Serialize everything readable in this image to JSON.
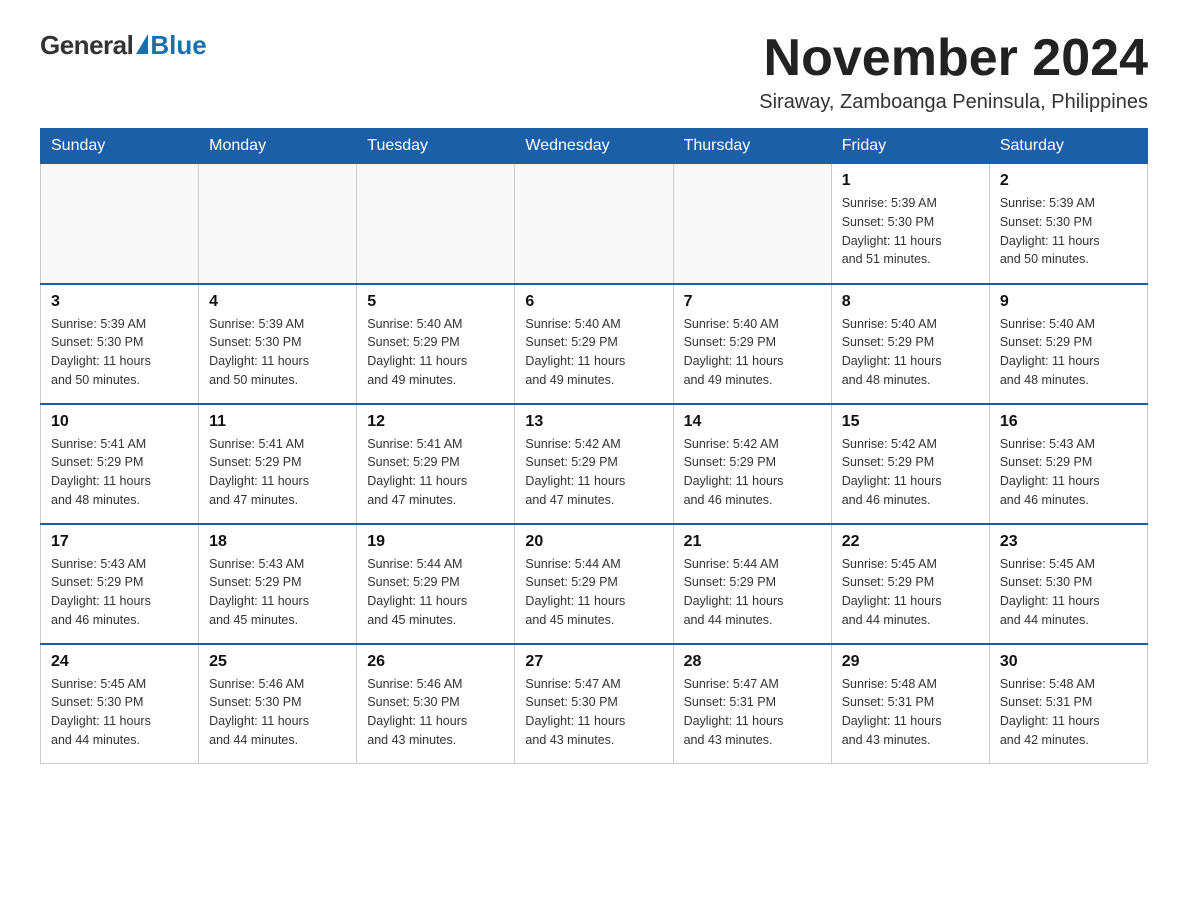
{
  "header": {
    "logo": {
      "general_text": "General",
      "blue_text": "Blue",
      "subtitle": ""
    },
    "title": "November 2024",
    "location": "Siraway, Zamboanga Peninsula, Philippines"
  },
  "days_of_week": [
    "Sunday",
    "Monday",
    "Tuesday",
    "Wednesday",
    "Thursday",
    "Friday",
    "Saturday"
  ],
  "weeks": [
    {
      "days": [
        {
          "num": "",
          "info": ""
        },
        {
          "num": "",
          "info": ""
        },
        {
          "num": "",
          "info": ""
        },
        {
          "num": "",
          "info": ""
        },
        {
          "num": "",
          "info": ""
        },
        {
          "num": "1",
          "info": "Sunrise: 5:39 AM\nSunset: 5:30 PM\nDaylight: 11 hours\nand 51 minutes."
        },
        {
          "num": "2",
          "info": "Sunrise: 5:39 AM\nSunset: 5:30 PM\nDaylight: 11 hours\nand 50 minutes."
        }
      ]
    },
    {
      "days": [
        {
          "num": "3",
          "info": "Sunrise: 5:39 AM\nSunset: 5:30 PM\nDaylight: 11 hours\nand 50 minutes."
        },
        {
          "num": "4",
          "info": "Sunrise: 5:39 AM\nSunset: 5:30 PM\nDaylight: 11 hours\nand 50 minutes."
        },
        {
          "num": "5",
          "info": "Sunrise: 5:40 AM\nSunset: 5:29 PM\nDaylight: 11 hours\nand 49 minutes."
        },
        {
          "num": "6",
          "info": "Sunrise: 5:40 AM\nSunset: 5:29 PM\nDaylight: 11 hours\nand 49 minutes."
        },
        {
          "num": "7",
          "info": "Sunrise: 5:40 AM\nSunset: 5:29 PM\nDaylight: 11 hours\nand 49 minutes."
        },
        {
          "num": "8",
          "info": "Sunrise: 5:40 AM\nSunset: 5:29 PM\nDaylight: 11 hours\nand 48 minutes."
        },
        {
          "num": "9",
          "info": "Sunrise: 5:40 AM\nSunset: 5:29 PM\nDaylight: 11 hours\nand 48 minutes."
        }
      ]
    },
    {
      "days": [
        {
          "num": "10",
          "info": "Sunrise: 5:41 AM\nSunset: 5:29 PM\nDaylight: 11 hours\nand 48 minutes."
        },
        {
          "num": "11",
          "info": "Sunrise: 5:41 AM\nSunset: 5:29 PM\nDaylight: 11 hours\nand 47 minutes."
        },
        {
          "num": "12",
          "info": "Sunrise: 5:41 AM\nSunset: 5:29 PM\nDaylight: 11 hours\nand 47 minutes."
        },
        {
          "num": "13",
          "info": "Sunrise: 5:42 AM\nSunset: 5:29 PM\nDaylight: 11 hours\nand 47 minutes."
        },
        {
          "num": "14",
          "info": "Sunrise: 5:42 AM\nSunset: 5:29 PM\nDaylight: 11 hours\nand 46 minutes."
        },
        {
          "num": "15",
          "info": "Sunrise: 5:42 AM\nSunset: 5:29 PM\nDaylight: 11 hours\nand 46 minutes."
        },
        {
          "num": "16",
          "info": "Sunrise: 5:43 AM\nSunset: 5:29 PM\nDaylight: 11 hours\nand 46 minutes."
        }
      ]
    },
    {
      "days": [
        {
          "num": "17",
          "info": "Sunrise: 5:43 AM\nSunset: 5:29 PM\nDaylight: 11 hours\nand 46 minutes."
        },
        {
          "num": "18",
          "info": "Sunrise: 5:43 AM\nSunset: 5:29 PM\nDaylight: 11 hours\nand 45 minutes."
        },
        {
          "num": "19",
          "info": "Sunrise: 5:44 AM\nSunset: 5:29 PM\nDaylight: 11 hours\nand 45 minutes."
        },
        {
          "num": "20",
          "info": "Sunrise: 5:44 AM\nSunset: 5:29 PM\nDaylight: 11 hours\nand 45 minutes."
        },
        {
          "num": "21",
          "info": "Sunrise: 5:44 AM\nSunset: 5:29 PM\nDaylight: 11 hours\nand 44 minutes."
        },
        {
          "num": "22",
          "info": "Sunrise: 5:45 AM\nSunset: 5:29 PM\nDaylight: 11 hours\nand 44 minutes."
        },
        {
          "num": "23",
          "info": "Sunrise: 5:45 AM\nSunset: 5:30 PM\nDaylight: 11 hours\nand 44 minutes."
        }
      ]
    },
    {
      "days": [
        {
          "num": "24",
          "info": "Sunrise: 5:45 AM\nSunset: 5:30 PM\nDaylight: 11 hours\nand 44 minutes."
        },
        {
          "num": "25",
          "info": "Sunrise: 5:46 AM\nSunset: 5:30 PM\nDaylight: 11 hours\nand 44 minutes."
        },
        {
          "num": "26",
          "info": "Sunrise: 5:46 AM\nSunset: 5:30 PM\nDaylight: 11 hours\nand 43 minutes."
        },
        {
          "num": "27",
          "info": "Sunrise: 5:47 AM\nSunset: 5:30 PM\nDaylight: 11 hours\nand 43 minutes."
        },
        {
          "num": "28",
          "info": "Sunrise: 5:47 AM\nSunset: 5:31 PM\nDaylight: 11 hours\nand 43 minutes."
        },
        {
          "num": "29",
          "info": "Sunrise: 5:48 AM\nSunset: 5:31 PM\nDaylight: 11 hours\nand 43 minutes."
        },
        {
          "num": "30",
          "info": "Sunrise: 5:48 AM\nSunset: 5:31 PM\nDaylight: 11 hours\nand 42 minutes."
        }
      ]
    }
  ]
}
